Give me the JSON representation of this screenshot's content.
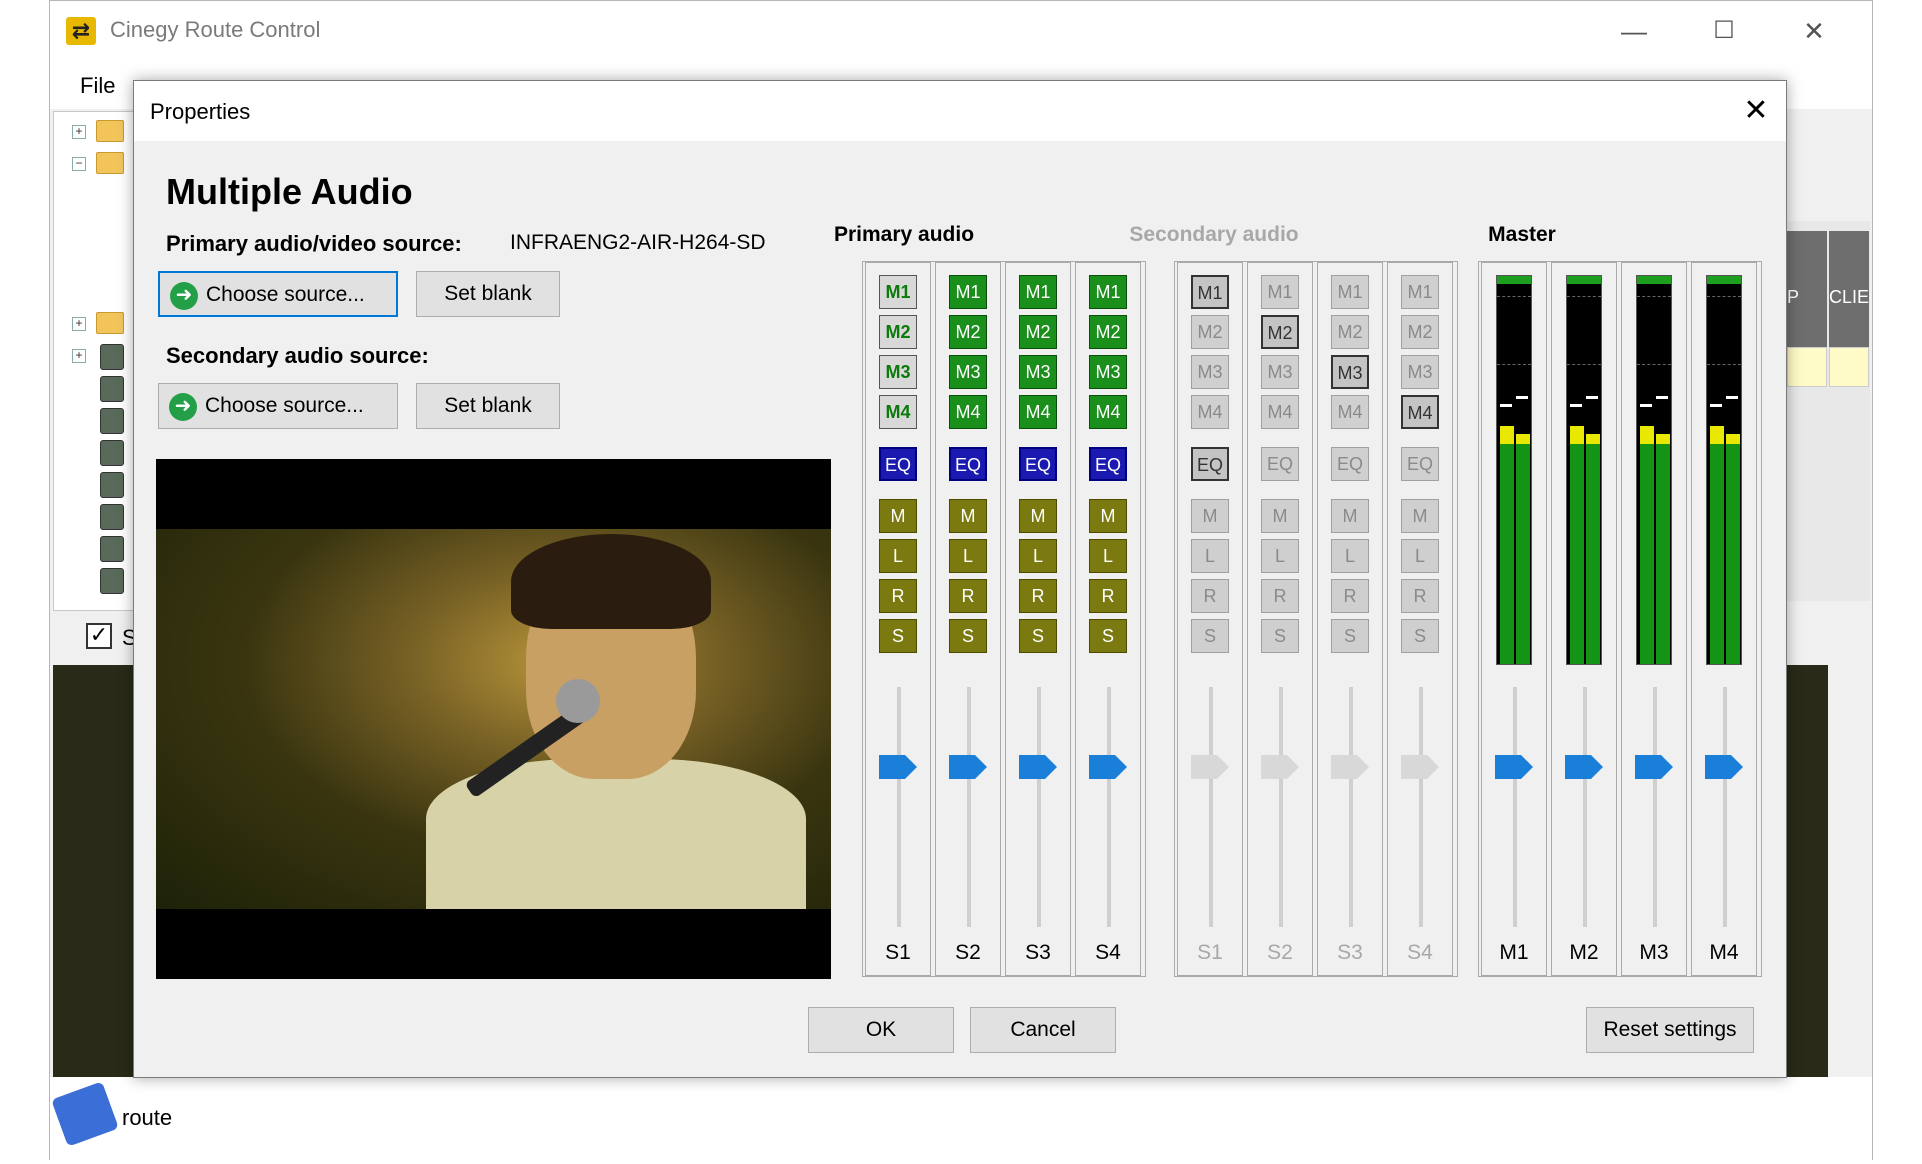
{
  "app": {
    "title": "Cinegy Route Control",
    "menu": [
      "File"
    ],
    "sidebar_checkbox_label": "S",
    "right_columns": [
      "P",
      "CLIEN"
    ],
    "status_label": "route"
  },
  "dialog": {
    "title": "Properties",
    "heading": "Multiple Audio",
    "primary_label": "Primary audio/video source:",
    "primary_value": "INFRAENG2-AIR-H264-SD",
    "secondary_label": "Secondary audio source:",
    "choose_source_label": "Choose source...",
    "set_blank_label": "Set blank",
    "ok_label": "OK",
    "cancel_label": "Cancel",
    "reset_label": "Reset settings"
  },
  "mixer": {
    "primary_title": "Primary audio",
    "secondary_title": "Secondary audio",
    "master_title": "Master",
    "primary_strips": [
      {
        "label": "S1",
        "routes": [
          "M1",
          "M2",
          "M3",
          "M4"
        ],
        "route_state": [
          "special",
          "special",
          "special",
          "special"
        ],
        "eq": "EQ",
        "eq_state": "on",
        "toggles": [
          "M",
          "L",
          "R",
          "S"
        ],
        "toggle_state": "on",
        "fader_state": "on"
      },
      {
        "label": "S2",
        "routes": [
          "M1",
          "M2",
          "M3",
          "M4"
        ],
        "route_state": [
          "on",
          "on",
          "on",
          "on"
        ],
        "eq": "EQ",
        "eq_state": "on",
        "toggles": [
          "M",
          "L",
          "R",
          "S"
        ],
        "toggle_state": "on",
        "fader_state": "on"
      },
      {
        "label": "S3",
        "routes": [
          "M1",
          "M2",
          "M3",
          "M4"
        ],
        "route_state": [
          "on",
          "on",
          "on",
          "on"
        ],
        "eq": "EQ",
        "eq_state": "on",
        "toggles": [
          "M",
          "L",
          "R",
          "S"
        ],
        "toggle_state": "on",
        "fader_state": "on"
      },
      {
        "label": "S4",
        "routes": [
          "M1",
          "M2",
          "M3",
          "M4"
        ],
        "route_state": [
          "on",
          "on",
          "on",
          "on"
        ],
        "eq": "EQ",
        "eq_state": "on",
        "toggles": [
          "M",
          "L",
          "R",
          "S"
        ],
        "toggle_state": "on",
        "fader_state": "on"
      }
    ],
    "secondary_strips": [
      {
        "label": "S1",
        "routes": [
          "M1",
          "M2",
          "M3",
          "M4"
        ],
        "route_state": [
          "sel",
          "off",
          "off",
          "off"
        ],
        "eq": "EQ",
        "eq_state": "sel",
        "toggles": [
          "M",
          "L",
          "R",
          "S"
        ],
        "toggle_state": "off",
        "fader_state": "off"
      },
      {
        "label": "S2",
        "routes": [
          "M1",
          "M2",
          "M3",
          "M4"
        ],
        "route_state": [
          "off",
          "sel",
          "off",
          "off"
        ],
        "eq": "EQ",
        "eq_state": "off",
        "toggles": [
          "M",
          "L",
          "R",
          "S"
        ],
        "toggle_state": "off",
        "fader_state": "off"
      },
      {
        "label": "S3",
        "routes": [
          "M1",
          "M2",
          "M3",
          "M4"
        ],
        "route_state": [
          "off",
          "off",
          "sel",
          "off"
        ],
        "eq": "EQ",
        "eq_state": "off",
        "toggles": [
          "M",
          "L",
          "R",
          "S"
        ],
        "toggle_state": "off",
        "fader_state": "off"
      },
      {
        "label": "S4",
        "routes": [
          "M1",
          "M2",
          "M3",
          "M4"
        ],
        "route_state": [
          "off",
          "off",
          "off",
          "sel"
        ],
        "eq": "EQ",
        "eq_state": "off",
        "toggles": [
          "M",
          "L",
          "R",
          "S"
        ],
        "toggle_state": "off",
        "fader_state": "off"
      }
    ],
    "master_strips": [
      {
        "label": "M1",
        "fader_state": "on"
      },
      {
        "label": "M2",
        "fader_state": "on"
      },
      {
        "label": "M3",
        "fader_state": "on"
      },
      {
        "label": "M4",
        "fader_state": "on"
      }
    ]
  },
  "colors": {
    "route_on": "#1b8f1b",
    "eq_on": "#1a1ab0",
    "toggle_on": "#7a7a10",
    "fader_on": "#1a7fd8",
    "meter_green": "#149414",
    "meter_yellow": "#e8e800"
  }
}
